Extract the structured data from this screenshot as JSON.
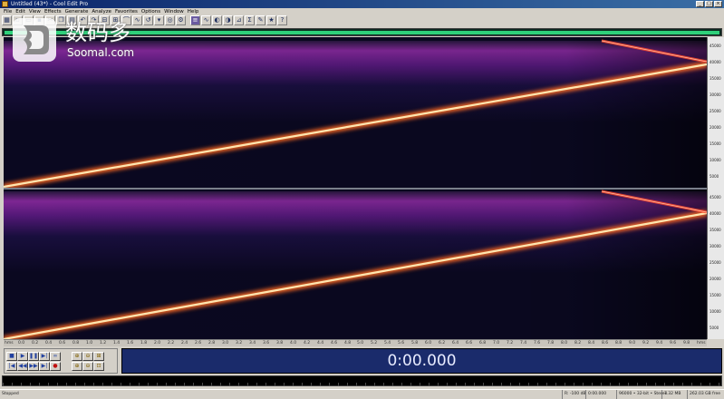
{
  "window": {
    "title": "Untitled (43*) - Cool Edit Pro",
    "controls": [
      "_",
      "□",
      "×"
    ]
  },
  "menu": [
    "File",
    "Edit",
    "View",
    "Effects",
    "Generate",
    "Analyze",
    "Favorites",
    "Options",
    "Window",
    "Help"
  ],
  "display": {
    "time": "0:00.000",
    "view": "spectral",
    "colors": {
      "overview": "#2fd07a",
      "sweep": "#ffe6b0",
      "noise": "#7a2a9a",
      "background": "#0a0820",
      "time_bg": "#1a2b6b"
    }
  },
  "freq_ruler": {
    "ticks": [
      "45000",
      "40000",
      "35000",
      "30000",
      "25000",
      "20000",
      "15000",
      "10000",
      "5000"
    ]
  },
  "time_ruler": {
    "ticks": [
      "hms",
      "0.0",
      "0.2",
      "0.4",
      "0.6",
      "0.8",
      "1.0",
      "1.2",
      "1.4",
      "1.6",
      "1.8",
      "2.0",
      "2.2",
      "2.4",
      "2.6",
      "2.8",
      "3.0",
      "3.2",
      "3.4",
      "3.6",
      "3.8",
      "4.0",
      "4.2",
      "4.4",
      "4.6",
      "4.8",
      "5.0",
      "5.2",
      "5.4",
      "5.6",
      "5.8",
      "6.0",
      "6.2",
      "6.4",
      "6.6",
      "6.8",
      "7.0",
      "7.2",
      "7.4",
      "7.6",
      "7.8",
      "8.0",
      "8.2",
      "8.4",
      "8.6",
      "8.8",
      "9.0",
      "9.2",
      "9.4",
      "9.6",
      "9.8",
      "hms"
    ]
  },
  "transport": {
    "buttons": [
      {
        "name": "stop-icon",
        "glyph": "■"
      },
      {
        "name": "play-icon",
        "glyph": "▶"
      },
      {
        "name": "pause-icon",
        "glyph": "❚❚"
      },
      {
        "name": "play-to-end-icon",
        "glyph": "▶|"
      },
      {
        "name": "loop-icon",
        "glyph": "∞"
      },
      {
        "name": "go-start-icon",
        "glyph": "|◀"
      },
      {
        "name": "rewind-icon",
        "glyph": "◀◀"
      },
      {
        "name": "fast-forward-icon",
        "glyph": "▶▶"
      },
      {
        "name": "go-end-icon",
        "glyph": "▶|"
      },
      {
        "name": "record-icon",
        "glyph": "●"
      }
    ],
    "zoom": [
      {
        "name": "zoom-in-horizontal-icon",
        "glyph": "⊕"
      },
      {
        "name": "zoom-out-horizontal-icon",
        "glyph": "⊖"
      },
      {
        "name": "zoom-full-icon",
        "glyph": "⊞"
      },
      {
        "name": "zoom-in-vertical-icon",
        "glyph": "⊕"
      },
      {
        "name": "zoom-out-vertical-icon",
        "glyph": "⊖"
      },
      {
        "name": "zoom-selection-icon",
        "glyph": "⊡"
      }
    ]
  },
  "status": {
    "state": "Stopped",
    "level": "R: -100 dB",
    "position": "0:00.000",
    "format": "96000 • 32-bit • Stereo",
    "size": "7.32 MB",
    "free": "262.03 GB free"
  },
  "watermark": {
    "cn": "数码多",
    "en": "Soomal.com"
  }
}
